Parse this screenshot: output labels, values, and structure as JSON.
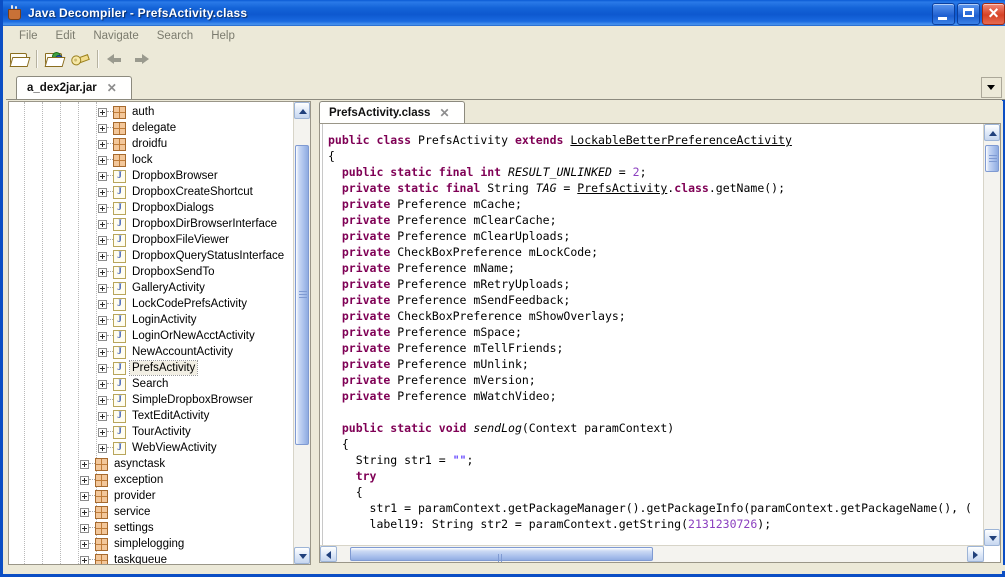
{
  "window": {
    "title": "Java Decompiler - PrefsActivity.class",
    "icon": "coffee-cup-icon",
    "buttons": {
      "minimize": "minimize",
      "maximize": "maximize",
      "close": "close"
    }
  },
  "menubar": {
    "items": [
      {
        "label": "File"
      },
      {
        "label": "Edit"
      },
      {
        "label": "Navigate"
      },
      {
        "label": "Search"
      },
      {
        "label": "Help"
      }
    ]
  },
  "toolbar": {
    "buttons": [
      {
        "name": "open-file-icon",
        "title": "Open File"
      },
      {
        "name": "open-type-icon",
        "title": "Open Type"
      },
      {
        "name": "key-icon",
        "title": "Preferences"
      },
      {
        "name": "back-arrow-icon",
        "title": "Back"
      },
      {
        "name": "forward-arrow-icon",
        "title": "Forward"
      }
    ]
  },
  "jar_tabs": {
    "tabs": [
      {
        "label": "a_dex2jar.jar",
        "close": "✕",
        "active": true
      }
    ],
    "overflow": "chevron-down-icon"
  },
  "tree": {
    "rows": [
      {
        "label": "auth",
        "icon": "package",
        "depth": 3,
        "expander": "+"
      },
      {
        "label": "delegate",
        "icon": "package",
        "depth": 3,
        "expander": "+"
      },
      {
        "label": "droidfu",
        "icon": "package",
        "depth": 3,
        "expander": "+"
      },
      {
        "label": "lock",
        "icon": "package",
        "depth": 3,
        "expander": "+"
      },
      {
        "label": "DropboxBrowser",
        "icon": "class",
        "depth": 3,
        "expander": "+"
      },
      {
        "label": "DropboxCreateShortcut",
        "icon": "class",
        "depth": 3,
        "expander": "+"
      },
      {
        "label": "DropboxDialogs",
        "icon": "class",
        "depth": 3,
        "expander": "+"
      },
      {
        "label": "DropboxDirBrowserInterface",
        "icon": "class",
        "depth": 3,
        "expander": "+"
      },
      {
        "label": "DropboxFileViewer",
        "icon": "class",
        "depth": 3,
        "expander": "+"
      },
      {
        "label": "DropboxQueryStatusInterface",
        "icon": "class",
        "depth": 3,
        "expander": "+"
      },
      {
        "label": "DropboxSendTo",
        "icon": "class",
        "depth": 3,
        "expander": "+"
      },
      {
        "label": "GalleryActivity",
        "icon": "class",
        "depth": 3,
        "expander": "+"
      },
      {
        "label": "LockCodePrefsActivity",
        "icon": "class",
        "depth": 3,
        "expander": "+"
      },
      {
        "label": "LoginActivity",
        "icon": "class",
        "depth": 3,
        "expander": "+"
      },
      {
        "label": "LoginOrNewAcctActivity",
        "icon": "class",
        "depth": 3,
        "expander": "+"
      },
      {
        "label": "NewAccountActivity",
        "icon": "class",
        "depth": 3,
        "expander": "+"
      },
      {
        "label": "PrefsActivity",
        "icon": "class",
        "depth": 3,
        "expander": "+",
        "selected": true
      },
      {
        "label": "Search",
        "icon": "class",
        "depth": 3,
        "expander": "+"
      },
      {
        "label": "SimpleDropboxBrowser",
        "icon": "class",
        "depth": 3,
        "expander": "+"
      },
      {
        "label": "TextEditActivity",
        "icon": "class",
        "depth": 3,
        "expander": "+"
      },
      {
        "label": "TourActivity",
        "icon": "class",
        "depth": 3,
        "expander": "+"
      },
      {
        "label": "WebViewActivity",
        "icon": "class",
        "depth": 3,
        "expander": "+"
      },
      {
        "label": "asynctask",
        "icon": "package",
        "depth": 2,
        "expander": "+"
      },
      {
        "label": "exception",
        "icon": "package",
        "depth": 2,
        "expander": "+"
      },
      {
        "label": "provider",
        "icon": "package",
        "depth": 2,
        "expander": "+"
      },
      {
        "label": "service",
        "icon": "package",
        "depth": 2,
        "expander": "+"
      },
      {
        "label": "settings",
        "icon": "package",
        "depth": 2,
        "expander": "+"
      },
      {
        "label": "simplelogging",
        "icon": "package",
        "depth": 2,
        "expander": "+"
      },
      {
        "label": "taskqueue",
        "icon": "package",
        "depth": 2,
        "expander": "+"
      }
    ],
    "scrollbar": {
      "thumb_top_pct": 6,
      "thumb_height_pct": 70
    }
  },
  "editor": {
    "tabs": [
      {
        "label": "PrefsActivity.class",
        "close": "✕",
        "active": true
      }
    ],
    "scrollbar_v": {
      "thumb_top_pct": 1,
      "thumb_height_pct": 7
    },
    "scrollbar_h": {
      "thumb_left_pct": 2,
      "thumb_width_pct": 48
    },
    "code_lines": [
      [
        {
          "t": "public class ",
          "c": "k"
        },
        {
          "t": "PrefsActivity ",
          "c": "t"
        },
        {
          "t": "extends ",
          "c": "k"
        },
        {
          "t": "LockableBetterPreferenceActivity",
          "c": "lnk"
        }
      ],
      [
        {
          "t": "{",
          "c": "t"
        }
      ],
      [
        {
          "t": "  public static final int ",
          "c": "k"
        },
        {
          "t": "RESULT_UNLINKED",
          "c": "f"
        },
        {
          "t": " = ",
          "c": "t"
        },
        {
          "t": "2",
          "c": "num"
        },
        {
          "t": ";",
          "c": "t"
        }
      ],
      [
        {
          "t": "  private static final ",
          "c": "k"
        },
        {
          "t": "String ",
          "c": "t"
        },
        {
          "t": "TAG",
          "c": "f"
        },
        {
          "t": " = ",
          "c": "t"
        },
        {
          "t": "PrefsActivity",
          "c": "lnk"
        },
        {
          "t": ".",
          "c": "t"
        },
        {
          "t": "class",
          "c": "k"
        },
        {
          "t": ".getName();",
          "c": "t"
        }
      ],
      [
        {
          "t": "  private ",
          "c": "k"
        },
        {
          "t": "Preference mCache;",
          "c": "t"
        }
      ],
      [
        {
          "t": "  private ",
          "c": "k"
        },
        {
          "t": "Preference mClearCache;",
          "c": "t"
        }
      ],
      [
        {
          "t": "  private ",
          "c": "k"
        },
        {
          "t": "Preference mClearUploads;",
          "c": "t"
        }
      ],
      [
        {
          "t": "  private ",
          "c": "k"
        },
        {
          "t": "CheckBoxPreference mLockCode;",
          "c": "t"
        }
      ],
      [
        {
          "t": "  private ",
          "c": "k"
        },
        {
          "t": "Preference mName;",
          "c": "t"
        }
      ],
      [
        {
          "t": "  private ",
          "c": "k"
        },
        {
          "t": "Preference mRetryUploads;",
          "c": "t"
        }
      ],
      [
        {
          "t": "  private ",
          "c": "k"
        },
        {
          "t": "Preference mSendFeedback;",
          "c": "t"
        }
      ],
      [
        {
          "t": "  private ",
          "c": "k"
        },
        {
          "t": "CheckBoxPreference mShowOverlays;",
          "c": "t"
        }
      ],
      [
        {
          "t": "  private ",
          "c": "k"
        },
        {
          "t": "Preference mSpace;",
          "c": "t"
        }
      ],
      [
        {
          "t": "  private ",
          "c": "k"
        },
        {
          "t": "Preference mTellFriends;",
          "c": "t"
        }
      ],
      [
        {
          "t": "  private ",
          "c": "k"
        },
        {
          "t": "Preference mUnlink;",
          "c": "t"
        }
      ],
      [
        {
          "t": "  private ",
          "c": "k"
        },
        {
          "t": "Preference mVersion;",
          "c": "t"
        }
      ],
      [
        {
          "t": "  private ",
          "c": "k"
        },
        {
          "t": "Preference mWatchVideo;",
          "c": "t"
        }
      ],
      [
        {
          "t": "",
          "c": "t"
        }
      ],
      [
        {
          "t": "  public static void ",
          "c": "k"
        },
        {
          "t": "sendLog",
          "c": "f"
        },
        {
          "t": "(Context paramContext)",
          "c": "t"
        }
      ],
      [
        {
          "t": "  {",
          "c": "t"
        }
      ],
      [
        {
          "t": "    String str1 = ",
          "c": "t"
        },
        {
          "t": "\"\"",
          "c": "str"
        },
        {
          "t": ";",
          "c": "t"
        }
      ],
      [
        {
          "t": "    try",
          "c": "k"
        }
      ],
      [
        {
          "t": "    {",
          "c": "t"
        }
      ],
      [
        {
          "t": "      str1 = paramContext.getPackageManager().getPackageInfo(paramContext.getPackageName(), (",
          "c": "t"
        }
      ],
      [
        {
          "t": "      label19: String str2 = paramContext.getString(",
          "c": "t"
        },
        {
          "t": "2131230726",
          "c": "num"
        },
        {
          "t": ");",
          "c": "t"
        }
      ]
    ]
  }
}
